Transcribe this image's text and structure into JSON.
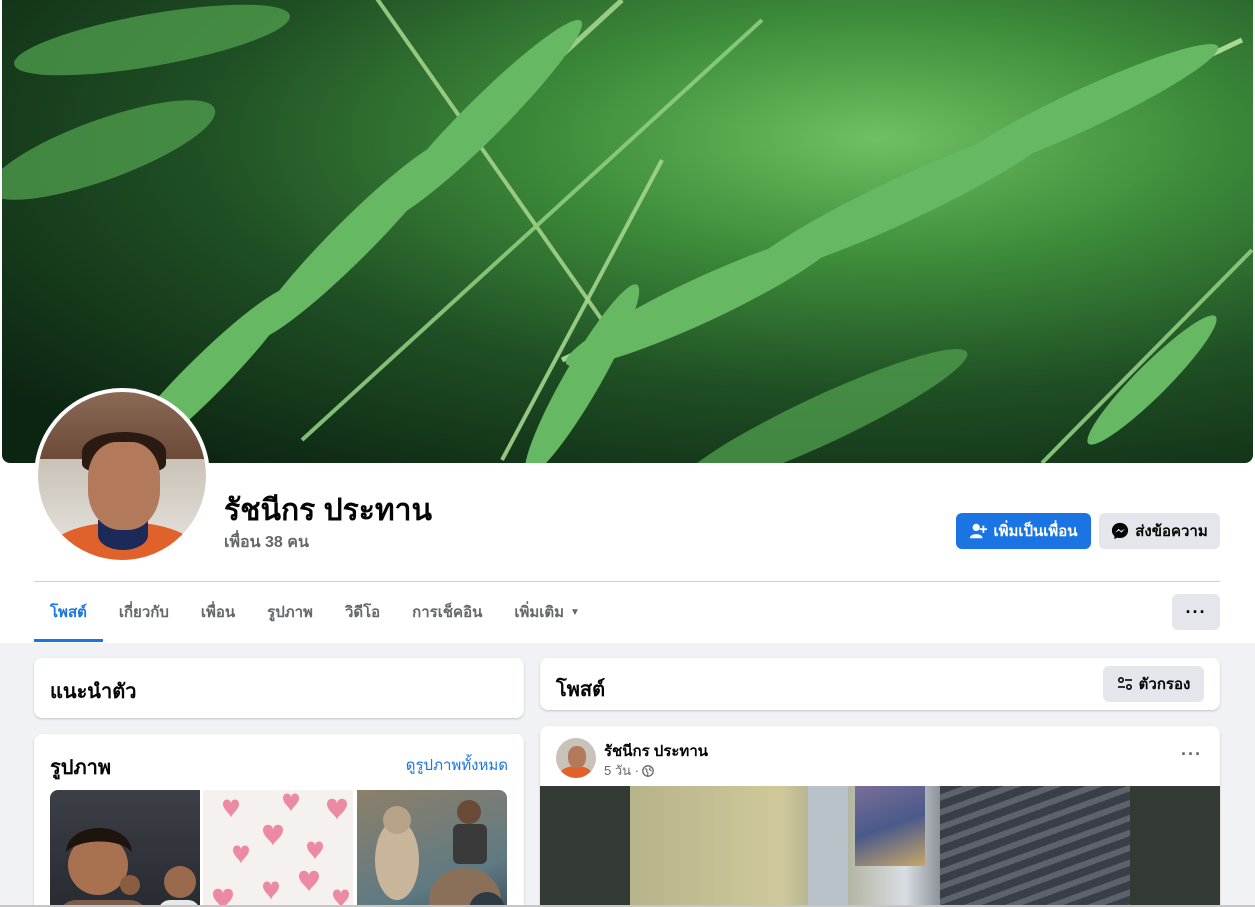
{
  "profile": {
    "name": "รัชนีกร ประทาน",
    "friends": "เพื่อน 38 คน"
  },
  "actions": {
    "add_friend": "เพิ่มเป็นเพื่อน",
    "message": "ส่งข้อความ",
    "more": "···"
  },
  "tabs": [
    {
      "label": "โพสต์",
      "active": true
    },
    {
      "label": "เกี่ยวกับ"
    },
    {
      "label": "เพื่อน"
    },
    {
      "label": "รูปภาพ"
    },
    {
      "label": "วิดีโอ"
    },
    {
      "label": "การเช็คอิน"
    },
    {
      "label": "เพิ่มเติม"
    }
  ],
  "intro": {
    "title": "แนะนำตัว"
  },
  "photos": {
    "title": "รูปภาพ",
    "see_all": "ดูรูปภาพทั้งหมด"
  },
  "posts": {
    "title": "โพสต์",
    "filter": "ตัวกรอง"
  },
  "post": {
    "author": "รัชนีกร ประทาน",
    "time": "5 วัน ·",
    "more": "···"
  },
  "colors": {
    "accent": "#1b74e4",
    "secondary_button": "#e4e6eb",
    "background": "#f0f2f5"
  }
}
